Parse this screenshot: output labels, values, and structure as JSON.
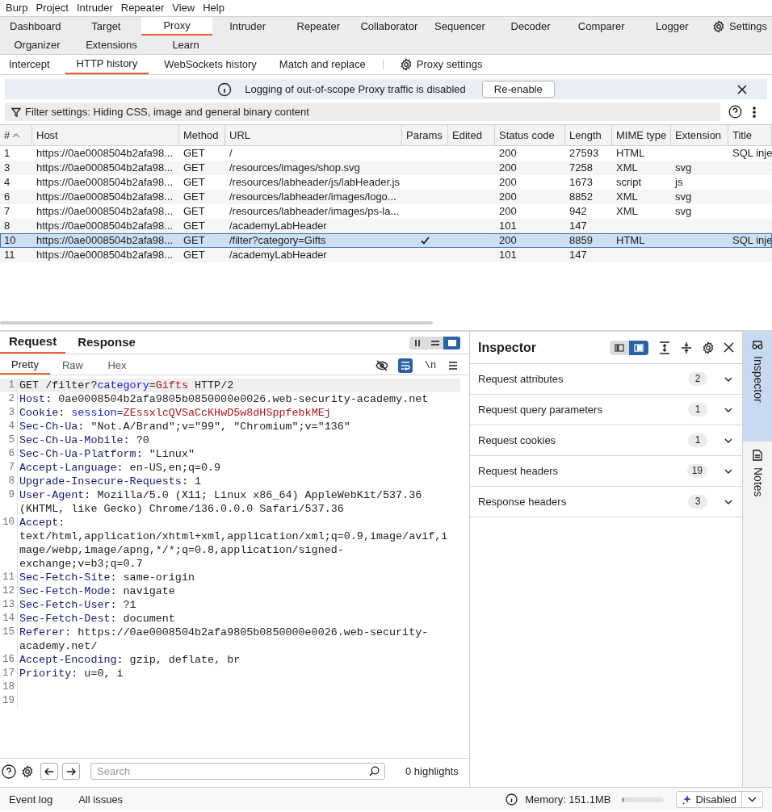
{
  "menu": [
    "Burp",
    "Project",
    "Intruder",
    "Repeater",
    "View",
    "Help"
  ],
  "main_tab_rows": [
    [
      {
        "label": "Dashboard",
        "selected": false
      },
      {
        "label": "Target",
        "selected": false
      },
      {
        "label": "Proxy",
        "selected": true
      },
      {
        "label": "Intruder",
        "selected": false
      },
      {
        "label": "Repeater",
        "selected": false
      },
      {
        "label": "Collaborator",
        "selected": false
      },
      {
        "label": "Sequencer",
        "selected": false
      },
      {
        "label": "Decoder",
        "selected": false
      },
      {
        "label": "Comparer",
        "selected": false
      },
      {
        "label": "Logger",
        "selected": false
      }
    ],
    [
      {
        "label": "Organizer",
        "selected": false
      },
      {
        "label": "Extensions",
        "selected": false
      },
      {
        "label": "Learn",
        "selected": false
      }
    ]
  ],
  "settings_tab": {
    "label": "Settings"
  },
  "proxy_tabs": [
    {
      "label": "Intercept",
      "selected": false
    },
    {
      "label": "HTTP history",
      "selected": true
    },
    {
      "label": "WebSockets history",
      "selected": false
    },
    {
      "label": "Match and replace",
      "selected": false
    }
  ],
  "proxy_settings": {
    "label": "Proxy settings"
  },
  "notice": {
    "text": "Logging of out-of-scope Proxy traffic is disabled",
    "button": "Re-enable"
  },
  "filter": {
    "text": "Filter settings: Hiding CSS, image and general binary content"
  },
  "table": {
    "columns": [
      "#",
      "Host",
      "Method",
      "URL",
      "Params",
      "Edited",
      "Status code",
      "Length",
      "MIME type",
      "Extension",
      "Title"
    ],
    "rows": [
      {
        "num": "1",
        "host": "https://0ae0008504b2afa98...",
        "method": "GET",
        "url": "/",
        "params": false,
        "status": "200",
        "length": "27593",
        "mime": "HTML",
        "title": "SQL inje",
        "selected": false
      },
      {
        "num": "3",
        "host": "https://0ae0008504b2afa98...",
        "method": "GET",
        "url": "/resources/images/shop.svg",
        "params": false,
        "status": "200",
        "length": "7258",
        "mime": "XML",
        "extension": "svg",
        "selected": false
      },
      {
        "num": "4",
        "host": "https://0ae0008504b2afa98...",
        "method": "GET",
        "url": "/resources/labheader/js/labHeader.js",
        "params": false,
        "status": "200",
        "length": "1673",
        "mime": "script",
        "extension": "js",
        "selected": false
      },
      {
        "num": "6",
        "host": "https://0ae0008504b2afa98...",
        "method": "GET",
        "url": "/resources/labheader/images/logo...",
        "params": false,
        "status": "200",
        "length": "8852",
        "mime": "XML",
        "extension": "svg",
        "selected": false
      },
      {
        "num": "7",
        "host": "https://0ae0008504b2afa98...",
        "method": "GET",
        "url": "/resources/labheader/images/ps-la...",
        "params": false,
        "status": "200",
        "length": "942",
        "mime": "XML",
        "extension": "svg",
        "selected": false
      },
      {
        "num": "8",
        "host": "https://0ae0008504b2afa98...",
        "method": "GET",
        "url": "/academyLabHeader",
        "params": false,
        "status": "101",
        "length": "147",
        "selected": false
      },
      {
        "num": "10",
        "host": "https://0ae0008504b2afa98...",
        "method": "GET",
        "url": "/filter?category=Gifts",
        "params": true,
        "status": "200",
        "length": "8859",
        "mime": "HTML",
        "title": "SQL inje",
        "selected": true
      },
      {
        "num": "11",
        "host": "https://0ae0008504b2afa98...",
        "method": "GET",
        "url": "/academyLabHeader",
        "params": false,
        "status": "101",
        "length": "147",
        "selected": false
      }
    ]
  },
  "request": {
    "tabs": [
      {
        "label": "Request",
        "selected": true
      },
      {
        "label": "Response",
        "selected": false
      }
    ],
    "layout_buttons": [
      {
        "selected": false
      },
      {
        "selected": false
      },
      {
        "selected": true
      }
    ],
    "view_tabs": [
      {
        "label": "Pretty",
        "selected": true
      },
      {
        "label": "Raw",
        "selected": false
      },
      {
        "label": "Hex",
        "selected": false
      }
    ],
    "wrap_on": true,
    "newline_toggle": "\\n",
    "lines": [
      {
        "number": "1",
        "parts": [
          {
            "kind": "plain",
            "text": "GET /filter?"
          },
          {
            "kind": "param",
            "text": "category"
          },
          {
            "kind": "plain",
            "text": "="
          },
          {
            "kind": "value",
            "text": "Gifts"
          },
          {
            "kind": "plain",
            "text": " HTTP/2"
          }
        ]
      },
      {
        "number": "2",
        "parts": [
          {
            "kind": "name",
            "text": "Host"
          },
          {
            "kind": "plain",
            "text": ": 0ae0008504b2afa9805b0850000e0026.web-security-academy.net"
          }
        ]
      },
      {
        "number": "3",
        "parts": [
          {
            "kind": "name",
            "text": "Cookie"
          },
          {
            "kind": "plain",
            "text": ": "
          },
          {
            "kind": "param",
            "text": "session"
          },
          {
            "kind": "plain",
            "text": "="
          },
          {
            "kind": "value",
            "text": "ZEssxlcQVSaCcKHwD5w8dHSppfebkMEj"
          }
        ]
      },
      {
        "number": "4",
        "parts": [
          {
            "kind": "name",
            "text": "Sec-Ch-Ua"
          },
          {
            "kind": "plain",
            "text": ": \"Not.A/Brand\";v=\"99\", \"Chromium\";v=\"136\""
          }
        ]
      },
      {
        "number": "5",
        "parts": [
          {
            "kind": "name",
            "text": "Sec-Ch-Ua-Mobile"
          },
          {
            "kind": "plain",
            "text": ": ?0"
          }
        ]
      },
      {
        "number": "6",
        "parts": [
          {
            "kind": "name",
            "text": "Sec-Ch-Ua-Platform"
          },
          {
            "kind": "plain",
            "text": ": \"Linux\""
          }
        ]
      },
      {
        "number": "7",
        "parts": [
          {
            "kind": "name",
            "text": "Accept-Language"
          },
          {
            "kind": "plain",
            "text": ": en-US,en;q=0.9"
          }
        ]
      },
      {
        "number": "8",
        "parts": [
          {
            "kind": "name",
            "text": "Upgrade-Insecure-Requests"
          },
          {
            "kind": "plain",
            "text": ": 1"
          }
        ]
      },
      {
        "number": "9",
        "parts": [
          {
            "kind": "name",
            "text": "User-Agent"
          },
          {
            "kind": "plain",
            "text": ": Mozilla/5.0 (X11; Linux x86_64) AppleWebKit/537.36 (KHTML, like Gecko) Chrome/136.0.0.0 Safari/537.36"
          }
        ]
      },
      {
        "number": "10",
        "parts": [
          {
            "kind": "name",
            "text": "Accept"
          },
          {
            "kind": "plain",
            "text": ": text/html,application/xhtml+xml,application/xml;q=0.9,image/avif,image/webp,image/apng,*/*;q=0.8,application/signed-exchange;v=b3;q=0.7"
          }
        ]
      },
      {
        "number": "11",
        "parts": [
          {
            "kind": "name",
            "text": "Sec-Fetch-Site"
          },
          {
            "kind": "plain",
            "text": ": same-origin"
          }
        ]
      },
      {
        "number": "12",
        "parts": [
          {
            "kind": "name",
            "text": "Sec-Fetch-Mode"
          },
          {
            "kind": "plain",
            "text": ": navigate"
          }
        ]
      },
      {
        "number": "13",
        "parts": [
          {
            "kind": "name",
            "text": "Sec-Fetch-User"
          },
          {
            "kind": "plain",
            "text": ": ?1"
          }
        ]
      },
      {
        "number": "14",
        "parts": [
          {
            "kind": "name",
            "text": "Sec-Fetch-Dest"
          },
          {
            "kind": "plain",
            "text": ": document"
          }
        ]
      },
      {
        "number": "15",
        "parts": [
          {
            "kind": "name",
            "text": "Referer"
          },
          {
            "kind": "plain",
            "text": ": https://0ae0008504b2afa9805b0850000e0026.web-security-academy.net/"
          }
        ]
      },
      {
        "number": "16",
        "parts": [
          {
            "kind": "name",
            "text": "Accept-Encoding"
          },
          {
            "kind": "plain",
            "text": ": gzip, deflate, br"
          }
        ]
      },
      {
        "number": "17",
        "parts": [
          {
            "kind": "name",
            "text": "Priority"
          },
          {
            "kind": "plain",
            "text": ": u=0, i"
          }
        ]
      },
      {
        "number": "18"
      },
      {
        "number": "19"
      }
    ],
    "search": {
      "placeholder": "Search",
      "highlights": "0 highlights"
    }
  },
  "inspector": {
    "title": "Inspector",
    "layout_buttons": [
      {
        "selected": false
      },
      {
        "selected": true
      }
    ],
    "sections": [
      {
        "label": "Request attributes",
        "count": "2"
      },
      {
        "label": "Request query parameters",
        "count": "1"
      },
      {
        "label": "Request cookies",
        "count": "1"
      },
      {
        "label": "Request headers",
        "count": "19"
      },
      {
        "label": "Response headers",
        "count": "3"
      }
    ]
  },
  "side_tabs": [
    {
      "label": "Inspector",
      "kind": "inspector",
      "selected": true
    },
    {
      "label": "Notes",
      "kind": "notes",
      "selected": false
    }
  ],
  "status_bar": {
    "items": [
      "Event log",
      "All issues"
    ],
    "memory": "Memory: 151.1MB",
    "memory_bar": {
      "level": 0.05
    },
    "ai_button": "Disabled"
  }
}
